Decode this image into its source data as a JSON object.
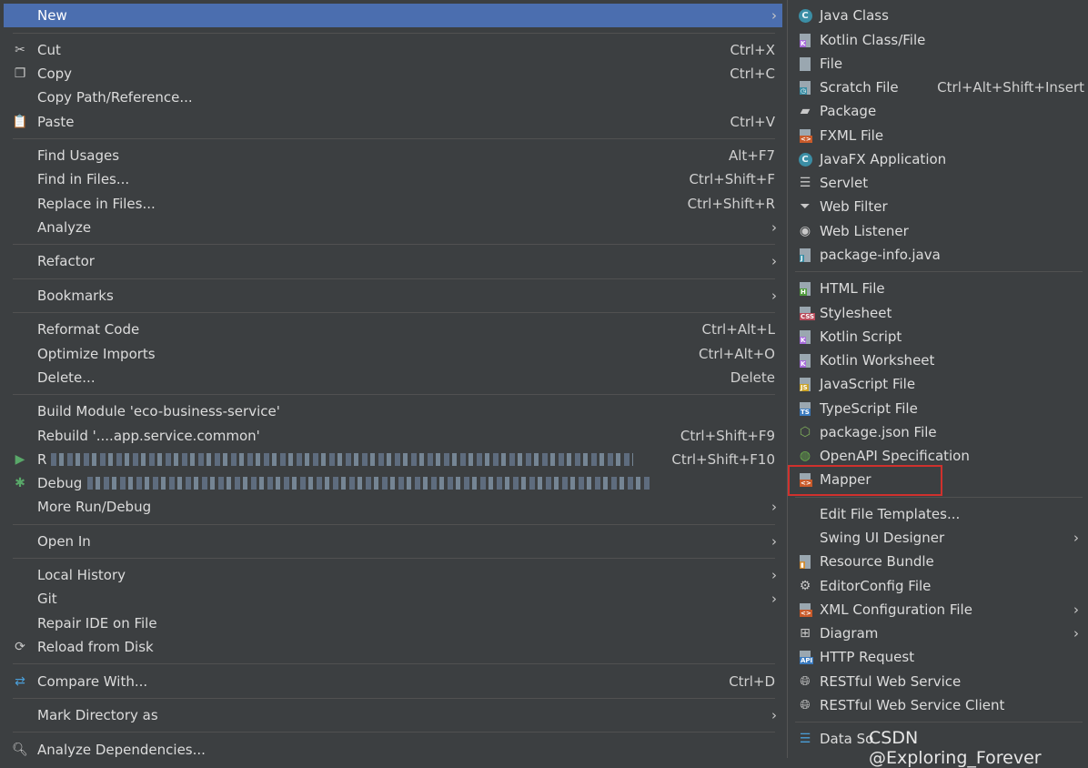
{
  "left_menu": {
    "new": {
      "label": "New"
    },
    "cut": {
      "label": "Cut",
      "shortcut": "Ctrl+X"
    },
    "copy": {
      "label": "Copy",
      "shortcut": "Ctrl+C"
    },
    "copy_path": {
      "label": "Copy Path/Reference..."
    },
    "paste": {
      "label": "Paste",
      "shortcut": "Ctrl+V"
    },
    "find_usages": {
      "label": "Find Usages",
      "shortcut": "Alt+F7"
    },
    "find_in_files": {
      "label": "Find in Files...",
      "shortcut": "Ctrl+Shift+F"
    },
    "replace_in_files": {
      "label": "Replace in Files...",
      "shortcut": "Ctrl+Shift+R"
    },
    "analyze": {
      "label": "Analyze"
    },
    "refactor": {
      "label": "Refactor"
    },
    "bookmarks": {
      "label": "Bookmarks"
    },
    "reformat_code": {
      "label": "Reformat Code",
      "shortcut": "Ctrl+Alt+L"
    },
    "optimize_imports": {
      "label": "Optimize Imports",
      "shortcut": "Ctrl+Alt+O"
    },
    "delete": {
      "label": "Delete...",
      "shortcut": "Delete"
    },
    "build_module": {
      "label": "Build Module 'eco-business-service'"
    },
    "rebuild": {
      "label": "Rebuild '....app.service.common'",
      "shortcut": "Ctrl+Shift+F9"
    },
    "run": {
      "label": "R",
      "shortcut": "Ctrl+Shift+F10"
    },
    "debug": {
      "label": "Debug"
    },
    "more_run_debug": {
      "label": "More Run/Debug"
    },
    "open_in": {
      "label": "Open In"
    },
    "local_history": {
      "label": "Local History"
    },
    "git": {
      "label": "Git"
    },
    "repair_ide": {
      "label": "Repair IDE on File"
    },
    "reload_from_disk": {
      "label": "Reload from Disk"
    },
    "compare_with": {
      "label": "Compare With...",
      "shortcut": "Ctrl+D"
    },
    "mark_directory_as": {
      "label": "Mark Directory as"
    },
    "analyze_dependencies": {
      "label": "Analyze Dependencies..."
    }
  },
  "right_menu": {
    "java_class": "Java Class",
    "kotlin_class": "Kotlin Class/File",
    "file": "File",
    "scratch_file": {
      "label": "Scratch File",
      "shortcut": "Ctrl+Alt+Shift+Insert"
    },
    "package": "Package",
    "fxml_file": "FXML File",
    "javafx_application": "JavaFX Application",
    "servlet": "Servlet",
    "web_filter": "Web Filter",
    "web_listener": "Web Listener",
    "package_info": "package-info.java",
    "html_file": "HTML File",
    "stylesheet": "Stylesheet",
    "kotlin_script": "Kotlin Script",
    "kotlin_worksheet": "Kotlin Worksheet",
    "javascript_file": "JavaScript File",
    "typescript_file": "TypeScript File",
    "package_json": "package.json File",
    "openapi_spec": "OpenAPI Specification",
    "mapper": "Mapper",
    "edit_file_templates": "Edit File Templates...",
    "swing_ui_designer": "Swing UI Designer",
    "resource_bundle": "Resource Bundle",
    "editorconfig_file": "EditorConfig File",
    "xml_configuration_file": "XML Configuration File",
    "diagram": "Diagram",
    "http_request": "HTTP Request",
    "restful_web_service": "RESTful Web Service",
    "restful_web_service_client": "RESTful Web Service Client",
    "data_source": "Data So"
  },
  "watermark": "CSDN @Exploring_Forever",
  "colors": {
    "background": "#3c3f41",
    "selection": "#4b6eaf",
    "highlight_border": "#d0312d"
  }
}
